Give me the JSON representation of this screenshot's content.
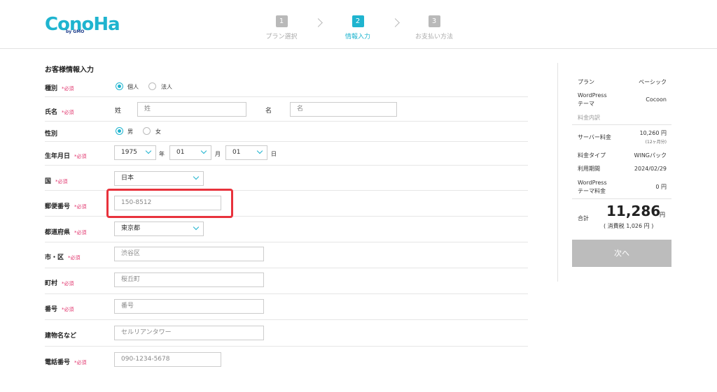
{
  "logo": {
    "text": "ConoHa",
    "sub": "by GMO"
  },
  "steps": [
    {
      "num": "1",
      "label": "プラン選択"
    },
    {
      "num": "2",
      "label": "情報入力"
    },
    {
      "num": "3",
      "label": "お支払い方法"
    }
  ],
  "form": {
    "title": "お客様情報入力",
    "required": "*必須",
    "type": {
      "label": "種別",
      "options": [
        "個人",
        "法人"
      ],
      "selected": "個人"
    },
    "name": {
      "label": "氏名",
      "last_label": "姓",
      "last_placeholder": "姓",
      "first_label": "名",
      "first_placeholder": "名"
    },
    "gender": {
      "label": "性別",
      "options": [
        "男",
        "女"
      ],
      "selected": "男"
    },
    "birth": {
      "label": "生年月日",
      "year": "1975",
      "year_unit": "年",
      "month": "01",
      "month_unit": "月",
      "day": "01",
      "day_unit": "日"
    },
    "country": {
      "label": "国",
      "value": "日本"
    },
    "postal": {
      "label": "郵便番号",
      "placeholder": "150-8512"
    },
    "prefecture": {
      "label": "都道府県",
      "value": "東京都"
    },
    "city": {
      "label": "市・区",
      "placeholder": "渋谷区"
    },
    "town": {
      "label": "町村",
      "placeholder": "桜丘町"
    },
    "number": {
      "label": "番号",
      "placeholder": "番号"
    },
    "building": {
      "label": "建物名など",
      "placeholder": "セルリアンタワー"
    },
    "phone": {
      "label": "電話番号",
      "placeholder": "090-1234-5678"
    }
  },
  "summary": {
    "plan_key": "プラン",
    "plan_val": "ベーシック",
    "theme_key": "WordPress\nテーマ",
    "theme_val": "Cocoon",
    "breakdown_label": "料金内訳",
    "server_key": "サーバー料金",
    "server_val": "10,260 円",
    "server_sub": "(12ヶ月分)",
    "type_key": "料金タイプ",
    "type_val": "WINGパック",
    "period_key": "利用期間",
    "period_val": "2024/02/29",
    "theme_fee_key": "WordPress\nテーマ料金",
    "theme_fee_val": "0 円",
    "total_key": "合計",
    "total_num": "11,286",
    "total_yen": "円",
    "total_tax": "( 消費税 1,026 円 )",
    "next_label": "次へ"
  },
  "colors": {
    "accent": "#1fb4cf",
    "required": "#e0306a",
    "highlight": "#e8323c",
    "button_disabled": "#bcbcbc"
  }
}
